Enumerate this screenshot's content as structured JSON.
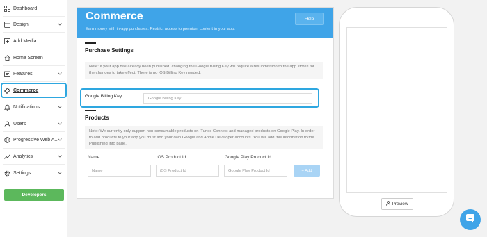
{
  "sidebar": {
    "items": [
      {
        "label": "Dashboard",
        "icon": "dashboard-icon",
        "chevron": false
      },
      {
        "label": "Design",
        "icon": "design-icon",
        "chevron": true
      },
      {
        "label": "Add Media",
        "icon": "add-media-icon",
        "chevron": false
      },
      {
        "label": "Home Screen",
        "icon": "home-icon",
        "chevron": false
      },
      {
        "label": "Features",
        "icon": "features-icon",
        "chevron": true
      },
      {
        "label": "Commerce",
        "icon": "tag-icon",
        "chevron": false,
        "active": true
      },
      {
        "label": "Notifications",
        "icon": "bell-icon",
        "chevron": true
      },
      {
        "label": "Users",
        "icon": "user-icon",
        "chevron": true
      },
      {
        "label": "Progressive Web A...",
        "icon": "globe-icon",
        "chevron": true
      },
      {
        "label": "Analytics",
        "icon": "analytics-icon",
        "chevron": true
      },
      {
        "label": "Settings",
        "icon": "gear-icon",
        "chevron": true
      }
    ],
    "developers_label": "Developers"
  },
  "header": {
    "title": "Commerce",
    "subtitle": "Earn money with in-app purchases. Restrict access to premium content in your app.",
    "help_label": "Help"
  },
  "purchase_settings": {
    "title": "Purchase Settings",
    "note": "Note: If your app has already been published, changing the Google Billing Key will require a resubmission to the app stores for the changes to take effect. There is no iOS Billing Key needed.",
    "billing_label": "Google Billing Key",
    "billing_placeholder": "Google Billing Key"
  },
  "products": {
    "title": "Products",
    "note": "Note: We currently only support non-consumable products on iTunes Connect and managed products on Google Play. In order to add products to your app you must add your own Google and Apple Developer accounts. You will add this information to the Publishing info page.",
    "col_name": "Name",
    "col_ios": "iOS Product Id",
    "col_google": "Google Play Product Id",
    "ph_name": "Name",
    "ph_ios": "iOS Product Id",
    "ph_google": "Google Play Product Id",
    "add_label": "+ Add"
  },
  "preview": {
    "button_label": "Preview"
  },
  "colors": {
    "accent": "#3fa4e8",
    "highlight": "#2ea7e0",
    "success": "#5cb85c"
  }
}
